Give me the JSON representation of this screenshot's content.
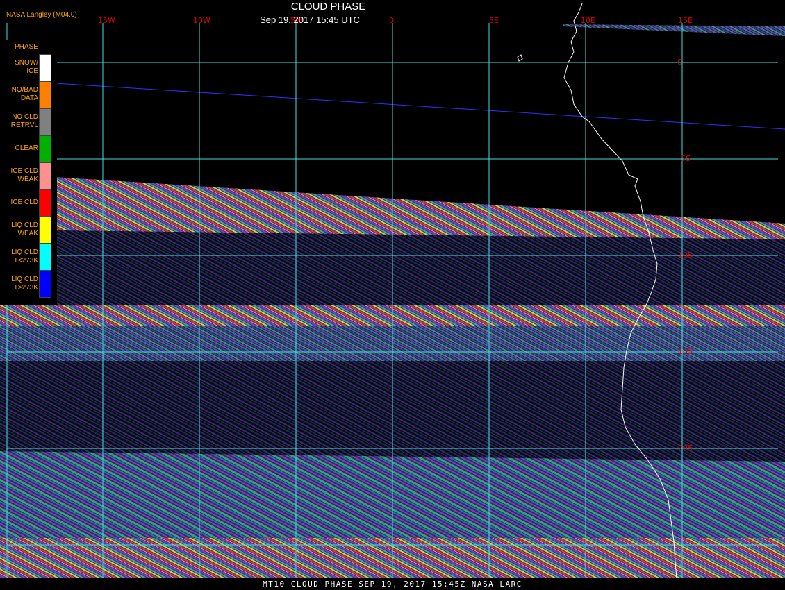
{
  "title": "CLOUD PHASE",
  "subtitle": "Sep 19, 2017 15:45 UTC",
  "agency": "NASA Langley (M04.0)",
  "footer": "MT10  CLOUD PHASE  SEP 19, 2017 15:45Z  NASA LARC",
  "legend": {
    "title": "PHASE",
    "items": [
      {
        "label": "SNOW/\nICE",
        "color": "#ffffff"
      },
      {
        "label": "NO/BAD\nDATA",
        "color": "#ff8000"
      },
      {
        "label": "NO CLD\nRETRVL",
        "color": "#808080"
      },
      {
        "label": "CLEAR",
        "color": "#00b000"
      },
      {
        "label": "ICE CLD\nWEAK",
        "color": "#ff9090"
      },
      {
        "label": "ICE CLD",
        "color": "#ff0000"
      },
      {
        "label": "LIQ CLD\nWEAK",
        "color": "#ffff00"
      },
      {
        "label": "LIQ CLD\nT<273K",
        "color": "#00ffff"
      },
      {
        "label": "LIQ CLD\nT>273K",
        "color": "#0000ff"
      }
    ]
  },
  "lon_labels": [
    "15W",
    "10W",
    "5W",
    "0",
    "5E",
    "10E",
    "15E"
  ],
  "lat_labels": [
    "0",
    "5S",
    "10S",
    "15S",
    "20S"
  ],
  "colors": {
    "grid": "#40e0e0",
    "coast": "#ffffff",
    "swath_edge": "#3030ff",
    "background": "#000000"
  }
}
